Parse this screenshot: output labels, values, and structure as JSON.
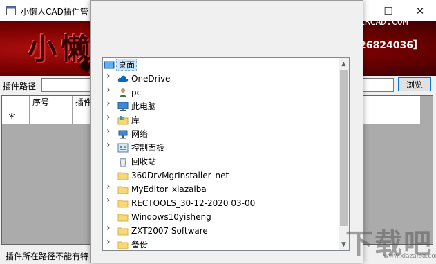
{
  "window": {
    "title": "小懒人CAD插件管",
    "controls": {
      "minimize": "—",
      "maximize": "☐",
      "close": "✕"
    }
  },
  "banner": {
    "logo": "小懒人",
    "url": "LRCAD.COM",
    "qq": "26824036】"
  },
  "path": {
    "label": "插件路径",
    "value": "",
    "browse_label": "浏览"
  },
  "grid": {
    "columns": [
      "",
      "序号",
      "插件"
    ],
    "new_row_marker": "＊"
  },
  "status": {
    "text": "插件所在路径不能有特"
  },
  "folder_tree": {
    "root": {
      "label": "桌面",
      "icon": "desktop-icon"
    },
    "items": [
      {
        "label": "OneDrive",
        "icon": "cloud-icon",
        "expandable": true
      },
      {
        "label": "pc",
        "icon": "user-icon",
        "expandable": true
      },
      {
        "label": "此电脑",
        "icon": "computer-icon",
        "expandable": true
      },
      {
        "label": "库",
        "icon": "library-icon",
        "expandable": true
      },
      {
        "label": "网络",
        "icon": "network-icon",
        "expandable": true
      },
      {
        "label": "控制面板",
        "icon": "control-panel-icon",
        "expandable": true
      },
      {
        "label": "回收站",
        "icon": "recycle-bin-icon",
        "expandable": false
      },
      {
        "label": "360DrvMgrInstaller_net",
        "icon": "folder-icon",
        "expandable": false
      },
      {
        "label": "MyEditor_xiazaiba",
        "icon": "folder-icon",
        "expandable": true
      },
      {
        "label": "RECTOOLS_30-12-2020 03-00",
        "icon": "folder-icon",
        "expandable": true
      },
      {
        "label": "Windows10yisheng",
        "icon": "folder-icon",
        "expandable": false
      },
      {
        "label": "ZXT2007 Software",
        "icon": "folder-icon",
        "expandable": true
      },
      {
        "label": "备份",
        "icon": "folder-icon",
        "expandable": true
      }
    ]
  },
  "watermark": {
    "main": "下载吧",
    "sub": "www.xiazaiba.com"
  },
  "colors": {
    "banner_red": "#8a0000",
    "selection": "#cce8ff",
    "folder": "#f8d775",
    "accent": "#0078d7"
  }
}
